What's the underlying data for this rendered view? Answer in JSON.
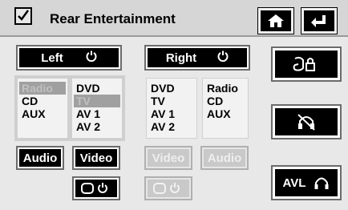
{
  "header": {
    "title": "Rear Entertainment",
    "home_icon": "home-icon",
    "back_icon": "back-arrow-icon"
  },
  "left": {
    "label": "Left",
    "sources_a": [
      "Radio",
      "CD",
      "AUX"
    ],
    "sources_b": [
      "DVD",
      "TV",
      "AV 1",
      "AV 2"
    ],
    "selected_a": "Radio",
    "selected_b": "TV",
    "audio_label": "Audio",
    "video_label": "Video"
  },
  "right": {
    "label": "Right",
    "sources_a": [
      "DVD",
      "TV",
      "AV 1",
      "AV 2"
    ],
    "sources_b": [
      "Radio",
      "CD",
      "AUX"
    ],
    "video_label": "Video",
    "audio_label": "Audio"
  },
  "side": {
    "avl_label": "AVL"
  },
  "colors": {
    "button_bg": "#000000",
    "selected_bg": "#a0a0a0",
    "disabled_bg": "#c9c9c9"
  }
}
